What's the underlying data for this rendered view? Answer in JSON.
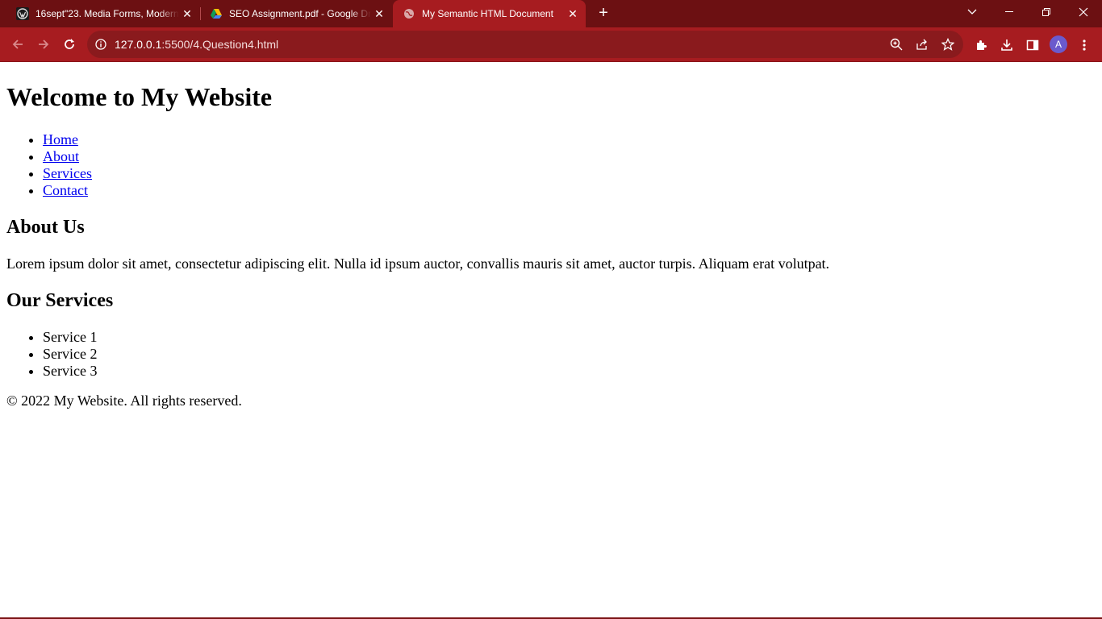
{
  "browser": {
    "tabs": [
      {
        "title": "16sept\"23. Media Forms, Modern"
      },
      {
        "title": "SEO Assignment.pdf - Google Dri"
      },
      {
        "title": "My Semantic HTML Document"
      }
    ],
    "url_host": "127.0.0.1",
    "url_path": ":5500/4.Question4.html",
    "profile_initial": "A",
    "colors": {
      "accent": "#a71c20",
      "tabstrip": "#6c1012"
    }
  },
  "page": {
    "heading": "Welcome to My Website",
    "nav": [
      "Home",
      "About",
      "Services",
      "Contact"
    ],
    "about": {
      "heading": "About Us",
      "text": "Lorem ipsum dolor sit amet, consectetur adipiscing elit. Nulla id ipsum auctor, convallis mauris sit amet, auctor turpis. Aliquam erat volutpat."
    },
    "services": {
      "heading": "Our Services",
      "items": [
        "Service 1",
        "Service 2",
        "Service 3"
      ]
    },
    "footer": "© 2022 My Website. All rights reserved."
  }
}
